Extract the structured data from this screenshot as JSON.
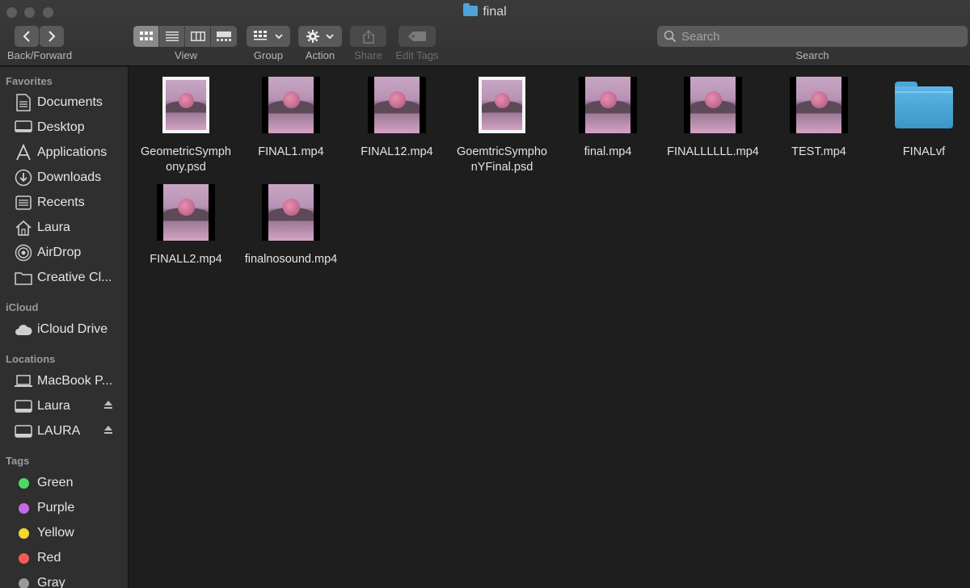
{
  "window": {
    "title": "final"
  },
  "toolbar": {
    "nav_label": "Back/Forward",
    "view_label": "View",
    "group_label": "Group",
    "action_label": "Action",
    "share_label": "Share",
    "edit_tags_label": "Edit Tags",
    "search_label": "Search",
    "search_placeholder": "Search",
    "active_view": "icon"
  },
  "sidebar": {
    "favorites_header": "Favorites",
    "favorites": [
      {
        "label": "Documents",
        "icon": "document-icon"
      },
      {
        "label": "Desktop",
        "icon": "desktop-icon"
      },
      {
        "label": "Applications",
        "icon": "applications-icon"
      },
      {
        "label": "Downloads",
        "icon": "download-icon"
      },
      {
        "label": "Recents",
        "icon": "recents-icon"
      },
      {
        "label": "Laura",
        "icon": "home-icon"
      },
      {
        "label": "AirDrop",
        "icon": "airdrop-icon"
      },
      {
        "label": "Creative Cl...",
        "icon": "folder-icon"
      }
    ],
    "icloud_header": "iCloud",
    "icloud": [
      {
        "label": "iCloud Drive",
        "icon": "cloud-icon"
      }
    ],
    "locations_header": "Locations",
    "locations": [
      {
        "label": "MacBook P...",
        "icon": "laptop-icon",
        "eject": false
      },
      {
        "label": "Laura",
        "icon": "drive-icon",
        "eject": true
      },
      {
        "label": "LAURA",
        "icon": "drive-icon",
        "eject": true
      }
    ],
    "tags_header": "Tags",
    "tags": [
      {
        "label": "Green",
        "color": "#4cd964"
      },
      {
        "label": "Purple",
        "color": "#c869e8"
      },
      {
        "label": "Yellow",
        "color": "#f5d732"
      },
      {
        "label": "Red",
        "color": "#f55a55"
      },
      {
        "label": "Gray",
        "color": "#9a9a9a"
      }
    ]
  },
  "files": [
    {
      "name": "GeometricSymphony.psd",
      "name_lines": [
        "GeometricSymph",
        "ony.psd"
      ],
      "kind": "psd"
    },
    {
      "name": "FINAL1.mp4",
      "name_lines": [
        "FINAL1.mp4"
      ],
      "kind": "video"
    },
    {
      "name": "FINAL12.mp4",
      "name_lines": [
        "FINAL12.mp4"
      ],
      "kind": "video"
    },
    {
      "name": "GoemtricSymphonYFinal.psd",
      "name_lines": [
        "GoemtricSympho",
        "nYFinal.psd"
      ],
      "kind": "psd"
    },
    {
      "name": "final.mp4",
      "name_lines": [
        "final.mp4"
      ],
      "kind": "video"
    },
    {
      "name": "FINALLLLLL.mp4",
      "name_lines": [
        "FINALLLLLL.mp4"
      ],
      "kind": "video"
    },
    {
      "name": "TEST.mp4",
      "name_lines": [
        "TEST.mp4"
      ],
      "kind": "video"
    },
    {
      "name": "FINALvf",
      "name_lines": [
        "FINALvf"
      ],
      "kind": "folder"
    },
    {
      "name": "FINALL2.mp4",
      "name_lines": [
        "FINALL2.mp4"
      ],
      "kind": "video"
    },
    {
      "name": "finalnosound.mp4",
      "name_lines": [
        "finalnosound.mp4"
      ],
      "kind": "video"
    }
  ]
}
